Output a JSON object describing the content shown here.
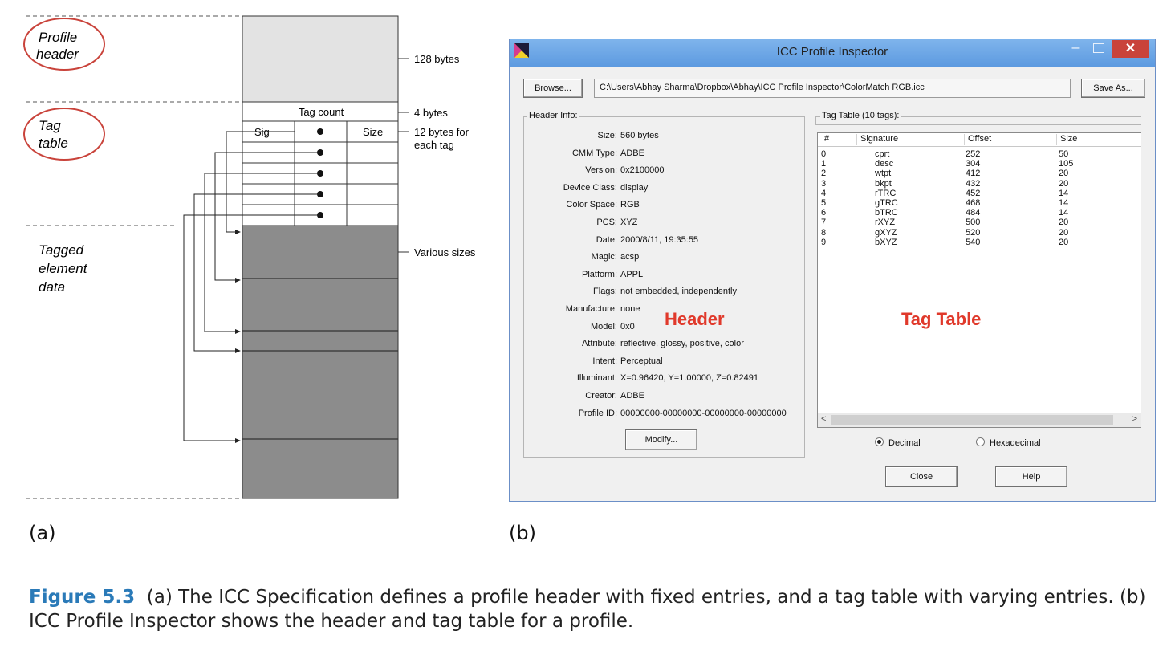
{
  "diagram": {
    "section_labels": {
      "profile_header": [
        "Profile",
        "header"
      ],
      "tag_table": [
        "Tag",
        "table"
      ],
      "tagged_element_data": [
        "Tagged",
        "element",
        "data"
      ]
    },
    "row_labels": {
      "tag_count": "Tag count",
      "sig": "Sig",
      "size": "Size"
    },
    "annotations": {
      "header_bytes": "128 bytes",
      "count_bytes": "4 bytes",
      "tag_bytes": [
        "12 bytes for",
        "each tag"
      ],
      "various": "Various sizes"
    }
  },
  "window": {
    "title": "ICC Profile Inspector",
    "browse_label": "Browse...",
    "path": "C:\\Users\\Abhay Sharma\\Dropbox\\Abhay\\ICC Profile Inspector\\ColorMatch RGB.icc",
    "saveas_label": "Save As...",
    "header_group_label": "Header Info:",
    "header_rows": [
      {
        "label": "Size:",
        "value": "560 bytes"
      },
      {
        "label": "CMM Type:",
        "value": "ADBE"
      },
      {
        "label": "Version:",
        "value": "0x2100000"
      },
      {
        "label": "Device Class:",
        "value": "display"
      },
      {
        "label": "Color Space:",
        "value": "RGB"
      },
      {
        "label": "PCS:",
        "value": "XYZ"
      },
      {
        "label": "Date:",
        "value": "2000/8/11, 19:35:55"
      },
      {
        "label": "Magic:",
        "value": "acsp"
      },
      {
        "label": "Platform:",
        "value": "APPL"
      },
      {
        "label": "Flags:",
        "value": "not embedded, independently"
      },
      {
        "label": "Manufacture:",
        "value": "none"
      },
      {
        "label": "Model:",
        "value": "0x0"
      },
      {
        "label": "Attribute:",
        "value": "reflective, glossy, positive, color"
      },
      {
        "label": "Intent:",
        "value": "Perceptual"
      },
      {
        "label": "Illuminant:",
        "value": "X=0.96420, Y=1.00000, Z=0.82491"
      },
      {
        "label": "Creator:",
        "value": "ADBE"
      },
      {
        "label": "Profile ID:",
        "value": "00000000-00000000-00000000-00000000"
      }
    ],
    "modify_label": "Modify...",
    "tag_group_label": "Tag Table (10 tags):",
    "tag_columns": [
      "#",
      "Signature",
      "Offset",
      "Size"
    ],
    "tag_rows": [
      [
        "0",
        "cprt",
        "252",
        "50"
      ],
      [
        "1",
        "desc",
        "304",
        "105"
      ],
      [
        "2",
        "wtpt",
        "412",
        "20"
      ],
      [
        "3",
        "bkpt",
        "432",
        "20"
      ],
      [
        "4",
        "rTRC",
        "452",
        "14"
      ],
      [
        "5",
        "gTRC",
        "468",
        "14"
      ],
      [
        "6",
        "bTRC",
        "484",
        "14"
      ],
      [
        "7",
        "rXYZ",
        "500",
        "20"
      ],
      [
        "8",
        "gXYZ",
        "520",
        "20"
      ],
      [
        "9",
        "bXYZ",
        "540",
        "20"
      ]
    ],
    "radio_decimal": "Decimal",
    "radio_hex": "Hexadecimal",
    "close_label": "Close",
    "help_label": "Help",
    "overlay_header": "Header",
    "overlay_tagtable": "Tag Table",
    "overlay_color": "#e0392b"
  },
  "panel_labels": {
    "a": "(a)",
    "b": "(b)"
  },
  "caption": {
    "figure": "Figure 5.3",
    "text": "(a) The ICC Specification defines a profile header with fixed entries, and a tag table with varying entries. (b) ICC Profile Inspector shows the header and tag table for a profile."
  }
}
